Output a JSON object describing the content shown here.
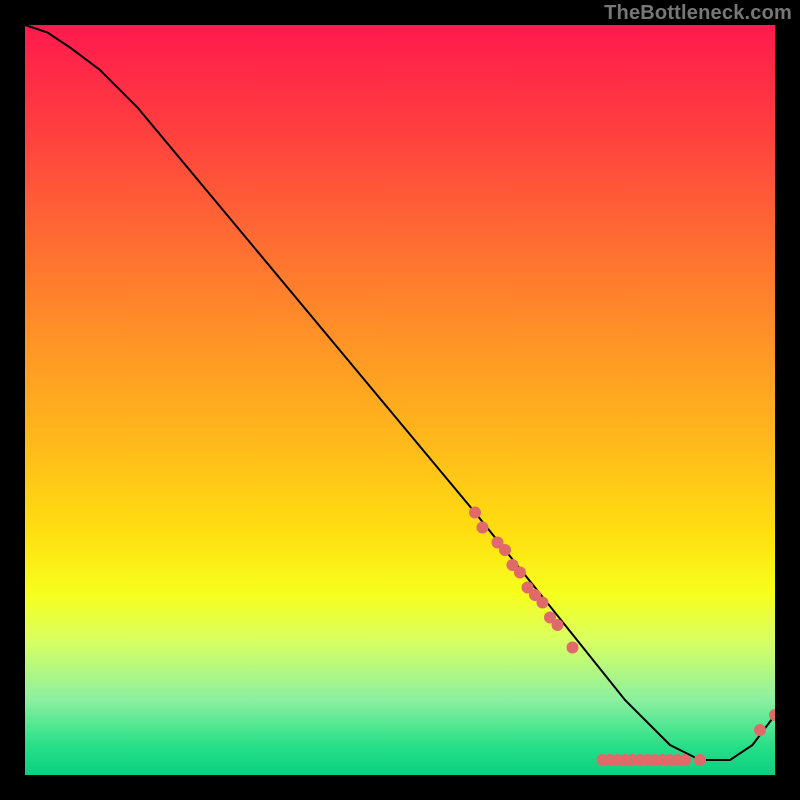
{
  "watermark": "TheBottleneck.com",
  "chart_data": {
    "type": "line",
    "title": "",
    "xlabel": "",
    "ylabel": "",
    "xlim": [
      0,
      100
    ],
    "ylim": [
      0,
      100
    ],
    "grid": false,
    "curve": {
      "x": [
        0,
        3,
        6,
        10,
        15,
        20,
        25,
        30,
        35,
        40,
        45,
        50,
        55,
        60,
        64,
        68,
        72,
        76,
        80,
        84,
        86,
        88,
        90,
        94,
        97,
        100
      ],
      "y": [
        100,
        99,
        97,
        94,
        89,
        83,
        77,
        71,
        65,
        59,
        53,
        47,
        41,
        35,
        30,
        25,
        20,
        15,
        10,
        6,
        4,
        3,
        2,
        2,
        4,
        8
      ]
    },
    "markers": [
      {
        "x": 60,
        "y": 35
      },
      {
        "x": 61,
        "y": 33
      },
      {
        "x": 63,
        "y": 31
      },
      {
        "x": 64,
        "y": 30
      },
      {
        "x": 65,
        "y": 28
      },
      {
        "x": 66,
        "y": 27
      },
      {
        "x": 67,
        "y": 25
      },
      {
        "x": 68,
        "y": 24
      },
      {
        "x": 69,
        "y": 23
      },
      {
        "x": 70,
        "y": 21
      },
      {
        "x": 71,
        "y": 20
      },
      {
        "x": 73,
        "y": 17
      },
      {
        "x": 77,
        "y": 2
      },
      {
        "x": 78,
        "y": 2
      },
      {
        "x": 79,
        "y": 2
      },
      {
        "x": 80,
        "y": 2
      },
      {
        "x": 81,
        "y": 2
      },
      {
        "x": 82,
        "y": 2
      },
      {
        "x": 83,
        "y": 2
      },
      {
        "x": 84,
        "y": 2
      },
      {
        "x": 85,
        "y": 2
      },
      {
        "x": 86,
        "y": 2
      },
      {
        "x": 87,
        "y": 2
      },
      {
        "x": 88,
        "y": 2
      },
      {
        "x": 90,
        "y": 2
      },
      {
        "x": 98,
        "y": 6
      },
      {
        "x": 100,
        "y": 8
      }
    ],
    "marker_color": "#e06a6a",
    "line_color": "#000000"
  }
}
